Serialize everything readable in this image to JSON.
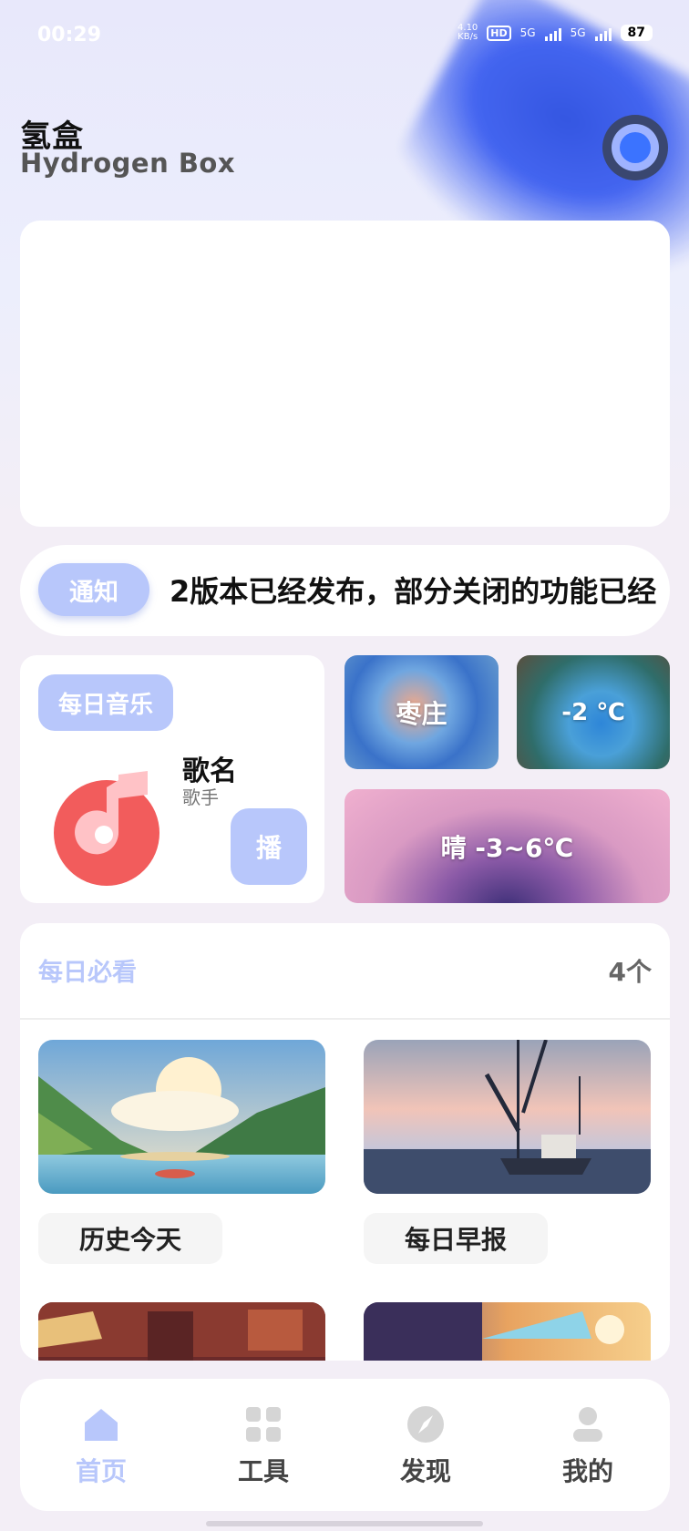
{
  "status_bar": {
    "time": "00:29",
    "net_speed_value": "4.10",
    "net_speed_unit": "KB/s",
    "hd_label": "HD",
    "signal1_label": "5G",
    "signal2_label": "5G",
    "battery": "87"
  },
  "header": {
    "title": "氢盒",
    "subtitle": "Hydrogen Box",
    "avatar_icon": "avatar-ring-icon"
  },
  "notice": {
    "tag": "通知",
    "text": "2版本已经发布，部分关闭的功能已经"
  },
  "music": {
    "tag": "每日音乐",
    "song_name": "歌名",
    "artist": "歌手",
    "play_label": "播",
    "icon": "music-note-icon",
    "accent_color": "#f25c5c"
  },
  "weather": {
    "city": "枣庄",
    "temperature": "-2 ℃",
    "forecast": "晴 -3~6℃"
  },
  "daily": {
    "title": "每日必看",
    "count": "4个",
    "items": [
      {
        "label": "历史今天",
        "image": "lake-mountains-illustration"
      },
      {
        "label": "每日早报",
        "image": "fishing-boat-illustration"
      },
      {
        "label": "",
        "image": "cafe-street-illustration"
      },
      {
        "label": "",
        "image": "rooftop-umbrella-illustration"
      }
    ]
  },
  "bottom_nav": {
    "items": [
      {
        "label": "首页",
        "icon": "home-icon",
        "active": true
      },
      {
        "label": "工具",
        "icon": "grid-icon",
        "active": false
      },
      {
        "label": "发现",
        "icon": "compass-icon",
        "active": false
      },
      {
        "label": "我的",
        "icon": "user-icon",
        "active": false
      }
    ]
  },
  "colors": {
    "accent": "#b8c7fb",
    "background": "#f3eef6",
    "card": "#ffffff"
  }
}
